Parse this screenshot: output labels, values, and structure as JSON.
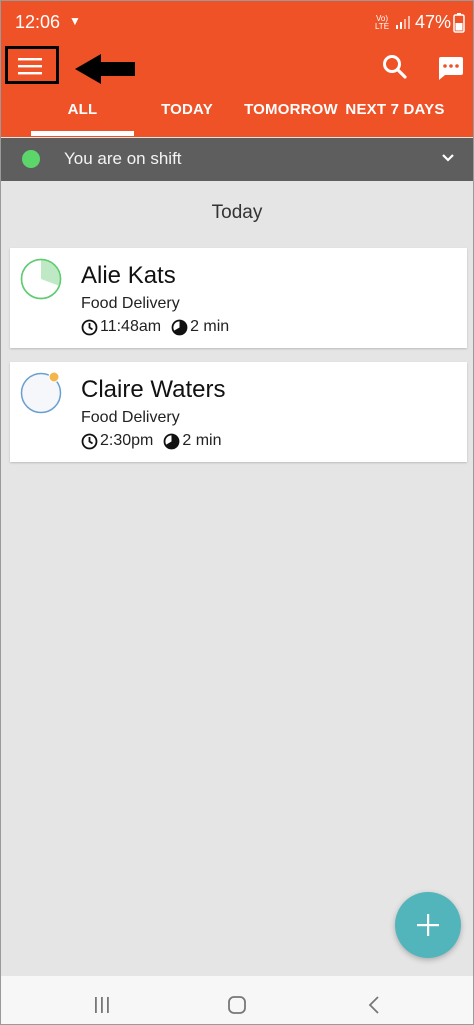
{
  "status_bar": {
    "time": "12:06",
    "network_badge": "Vo) LTE",
    "battery": "47%"
  },
  "toolbar": {
    "menu_icon": "hamburger-menu-icon",
    "search_icon": "search-icon",
    "chat_icon": "chat-bubble-icon"
  },
  "tabs": [
    {
      "label": "ALL",
      "selected": true
    },
    {
      "label": "TODAY",
      "selected": false
    },
    {
      "label": "TOMORROW",
      "selected": false
    },
    {
      "label": "NEXT 7 DAYS",
      "selected": false
    }
  ],
  "shift": {
    "status_text": "You are on shift",
    "status_color": "#5cd66a"
  },
  "section": {
    "heading": "Today"
  },
  "tasks": [
    {
      "name": "Alie Kats",
      "type": "Food Delivery",
      "time": "11:48am",
      "duration": "2 min",
      "ring_color": "#5fcc6f"
    },
    {
      "name": "Claire Waters",
      "type": "Food Delivery",
      "time": "2:30pm",
      "duration": "2 min",
      "ring_color": "#6a9fd0"
    }
  ],
  "fab": {
    "icon": "plus-icon"
  },
  "nav": {
    "recent_icon": "recent-apps-icon",
    "home_icon": "home-icon",
    "back_icon": "back-icon"
  },
  "colors": {
    "brand": "#f05227",
    "shift_bar": "#5e5e5e",
    "fab": "#52b5bb"
  }
}
